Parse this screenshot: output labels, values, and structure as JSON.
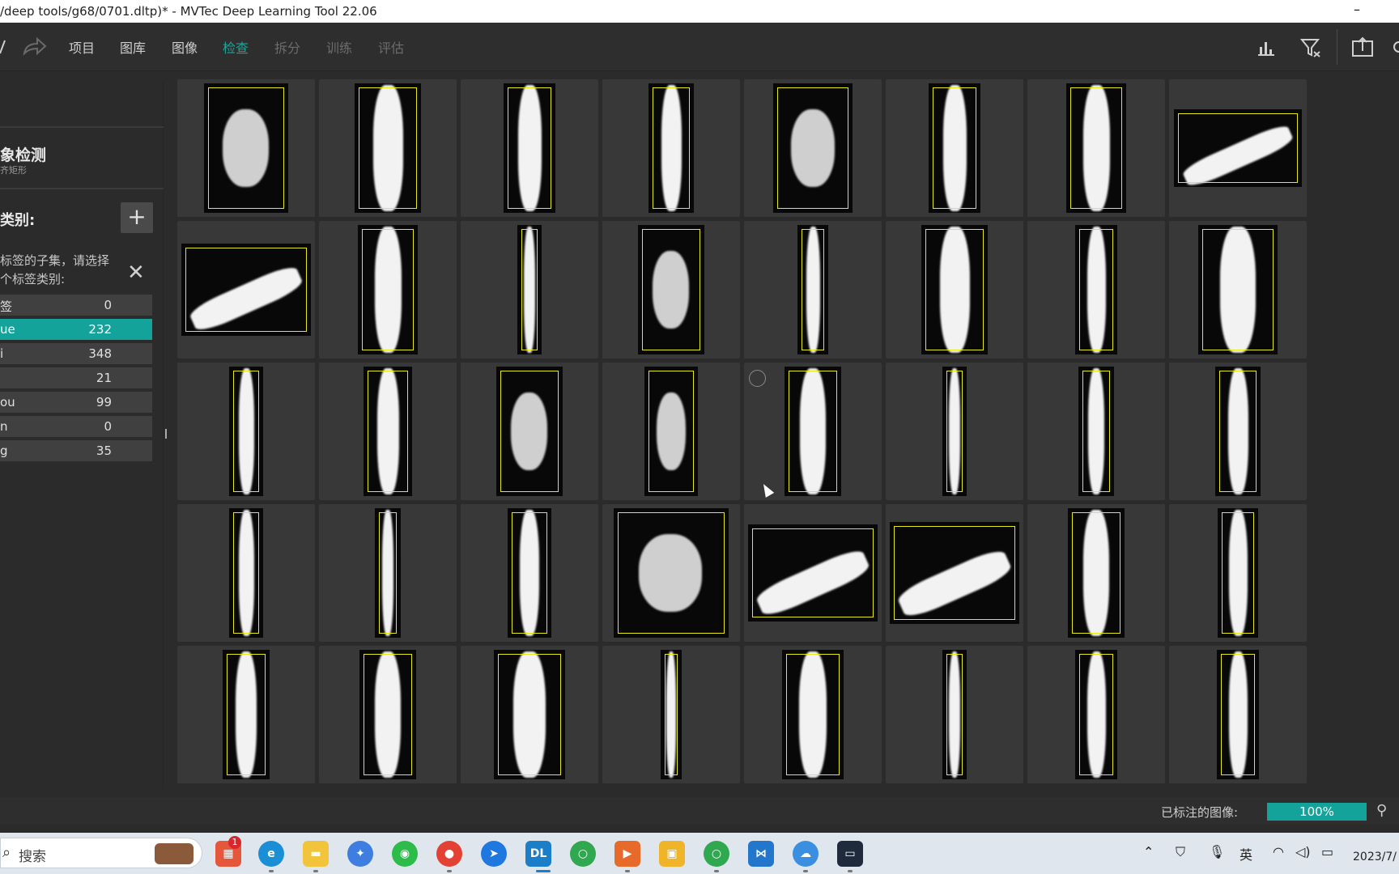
{
  "window": {
    "title": "/deep tools/g68/0701.dltp)* - MVTec Deep Learning Tool 22.06",
    "minimize_glyph": "–"
  },
  "toolbar": {
    "tabs": [
      {
        "label": "项目",
        "state": "normal"
      },
      {
        "label": "图库",
        "state": "normal"
      },
      {
        "label": "图像",
        "state": "normal"
      },
      {
        "label": "检查",
        "state": "active"
      },
      {
        "label": "拆分",
        "state": "disabled"
      },
      {
        "label": "训练",
        "state": "disabled"
      },
      {
        "label": "评估",
        "state": "disabled"
      }
    ],
    "accent_color": "#19a59a",
    "right_icons": [
      "statistics-icon",
      "filter-icon",
      "export-icon"
    ]
  },
  "sidebar": {
    "method_title": "象检测",
    "method_subtitle": "齐矩形",
    "class_section_title": "类别:",
    "add_button": "+",
    "note_line1": "标签的子集，请选择",
    "note_line2": "个标签类别:",
    "classes": [
      {
        "name": "签",
        "count": "0",
        "selected": false
      },
      {
        "name": "ue",
        "count": "232",
        "selected": true
      },
      {
        "name": "i",
        "count": "348",
        "selected": false
      },
      {
        "name": "",
        "count": "21",
        "selected": false
      },
      {
        "name": "ou",
        "count": "99",
        "selected": false
      },
      {
        "name": "n",
        "count": "0",
        "selected": false
      },
      {
        "name": "g",
        "count": "35",
        "selected": false
      }
    ]
  },
  "status": {
    "labeled_label": "已标注的图像:",
    "progress_text": "100%",
    "progress_value": 1.0
  },
  "taskbar": {
    "search_placeholder": "搜索",
    "badge_count": "1",
    "ime_label": "英",
    "clock": "2023/7/"
  }
}
